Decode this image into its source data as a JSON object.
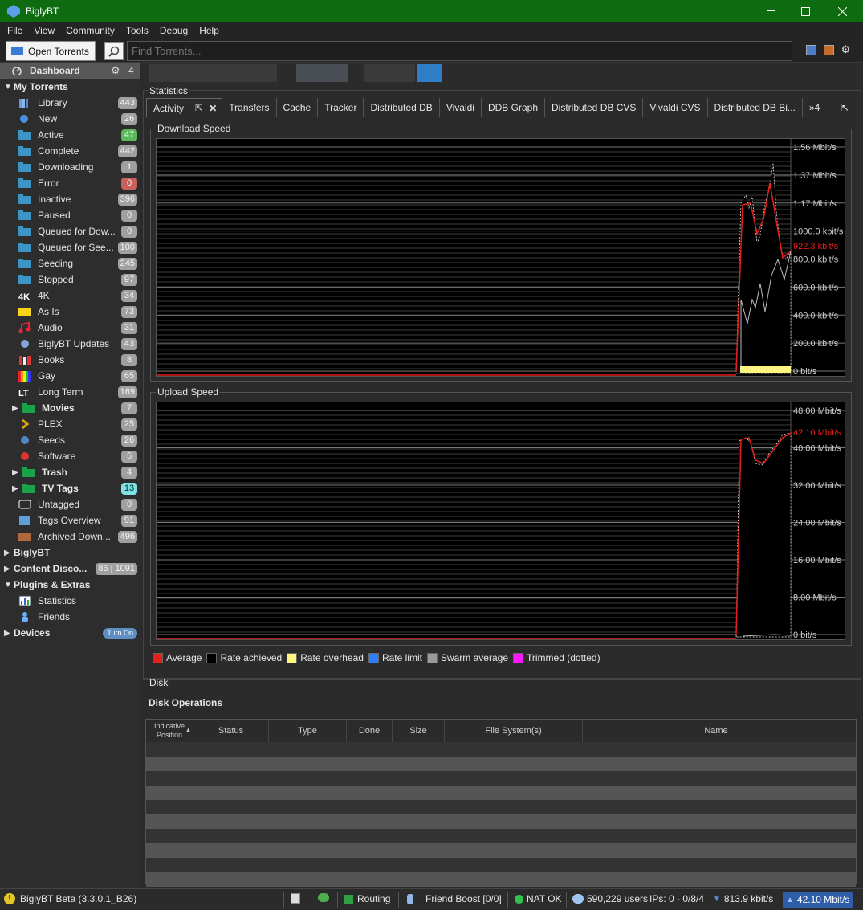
{
  "window": {
    "title": "BiglyBT",
    "minimize": "—",
    "maximize": "☐",
    "close": "✕"
  },
  "menu": [
    "File",
    "View",
    "Community",
    "Tools",
    "Debug",
    "Help"
  ],
  "toolbar": {
    "open_label": "Open Torrents",
    "search_placeholder": "Find Torrents..."
  },
  "sidebar": {
    "dashboard": {
      "label": "Dashboard",
      "count": "4"
    },
    "sections": [
      {
        "label": "My Torrents"
      },
      {
        "label": "BiglyBT"
      },
      {
        "label": "Content Disco...",
        "count": "86 | 1091"
      },
      {
        "label": "Plugins & Extras"
      },
      {
        "label": "Devices",
        "badge": "Turn On"
      }
    ],
    "items": [
      {
        "label": "Library",
        "count": "443",
        "icon": "library-icon"
      },
      {
        "label": "New",
        "count": "26",
        "icon": "new-icon"
      },
      {
        "label": "Active",
        "count": "47",
        "icon": "folder-icon",
        "badge_color": "#5cb85c"
      },
      {
        "label": "Complete",
        "count": "442",
        "icon": "folder-icon"
      },
      {
        "label": "Downloading",
        "count": "1",
        "icon": "folder-icon"
      },
      {
        "label": "Error",
        "count": "0",
        "icon": "folder-icon",
        "badge_color": "#c9605a"
      },
      {
        "label": "Inactive",
        "count": "396",
        "icon": "folder-icon"
      },
      {
        "label": "Paused",
        "count": "0",
        "icon": "folder-icon"
      },
      {
        "label": "Queued for Dow...",
        "count": "0",
        "icon": "folder-icon"
      },
      {
        "label": "Queued for See...",
        "count": "100",
        "icon": "folder-icon"
      },
      {
        "label": "Seeding",
        "count": "245",
        "icon": "folder-icon"
      },
      {
        "label": "Stopped",
        "count": "97",
        "icon": "folder-icon"
      },
      {
        "label": "4K",
        "count": "34",
        "icon": "4k-icon"
      },
      {
        "label": "As Is",
        "count": "73",
        "icon": "as-is-icon"
      },
      {
        "label": "Audio",
        "count": "31",
        "icon": "music-icon"
      },
      {
        "label": "BiglyBT Updates",
        "count": "43",
        "icon": "updates-icon"
      },
      {
        "label": "Books",
        "count": "8",
        "icon": "books-icon"
      },
      {
        "label": "Gay",
        "count": "65",
        "icon": "rainbow-icon"
      },
      {
        "label": "Long Term",
        "count": "169",
        "icon": "lt-icon"
      },
      {
        "label": "Movies",
        "count": "7",
        "icon": "tag-group-icon",
        "group": true
      },
      {
        "label": "PLEX",
        "count": "25",
        "icon": "plex-icon"
      },
      {
        "label": "Seeds",
        "count": "26",
        "icon": "seeds-icon"
      },
      {
        "label": "Software",
        "count": "5",
        "icon": "software-icon"
      },
      {
        "label": "Trash",
        "count": "4",
        "icon": "tag-group-icon",
        "group": true
      },
      {
        "label": "TV Tags",
        "count": "13",
        "icon": "tag-group-icon",
        "group": true,
        "badge_color": "#7fe0e6"
      },
      {
        "label": "Untagged",
        "count": "0",
        "icon": "untagged-icon"
      },
      {
        "label": "Tags Overview",
        "count": "91",
        "icon": "tags-overview-icon"
      },
      {
        "label": "Archived Down...",
        "count": "496",
        "icon": "archive-icon"
      }
    ],
    "plugins": [
      {
        "label": "Statistics",
        "icon": "statistics-icon"
      },
      {
        "label": "Friends",
        "icon": "friends-icon"
      }
    ]
  },
  "main": {
    "statistics_label": "Statistics",
    "tabs": [
      "Activity",
      "Transfers",
      "Cache",
      "Tracker",
      "Distributed DB",
      "Vivaldi",
      "DDB Graph",
      "Distributed DB CVS",
      "Vivaldi CVS",
      "Distributed DB Bi..."
    ],
    "tabs_more": "»4",
    "download": {
      "title": "Download Speed",
      "ticks": [
        "1.56 Mbit/s",
        "1.37 Mbit/s",
        "1.17 Mbit/s",
        "1000.0 kbit/s",
        "800.0 kbit/s",
        "600.0 kbit/s",
        "400.0 kbit/s",
        "200.0 kbit/s",
        "0 bit/s"
      ],
      "marker": "922.3 kbit/s"
    },
    "upload": {
      "title": "Upload Speed",
      "ticks": [
        "48.00 Mbit/s",
        "40.00 Mbit/s",
        "32.00 Mbit/s",
        "24.00 Mbit/s",
        "16.00 Mbit/s",
        "8.00 Mbit/s",
        "0 bit/s"
      ],
      "marker": "42.10 Mbit/s"
    },
    "legend": [
      {
        "label": "Average",
        "color": "#e8201c"
      },
      {
        "label": "Rate achieved",
        "color": "#000000"
      },
      {
        "label": "Rate overhead",
        "color": "#fdf481"
      },
      {
        "label": "Rate limit",
        "color": "#2f7dff"
      },
      {
        "label": "Swarm average",
        "color": "#9a9a9a"
      },
      {
        "label": "Trimmed (dotted)",
        "color": "#ff18ff"
      }
    ],
    "disk": {
      "section": "Disk",
      "title": "Disk Operations",
      "columns": [
        "Indicative Position",
        "Status",
        "Type",
        "Done",
        "Size",
        "File System(s)",
        "Name"
      ]
    }
  },
  "statusbar": {
    "version": "BiglyBT Beta (3.3.0.1_B26)",
    "routing": "Routing",
    "friend": "Friend Boost [0/0]",
    "nat": "NAT OK",
    "users": "590,229 users",
    "ips": "IPs: 0 - 0/8/4",
    "down": "813.9 kbit/s",
    "up": "42.10 Mbit/s"
  }
}
